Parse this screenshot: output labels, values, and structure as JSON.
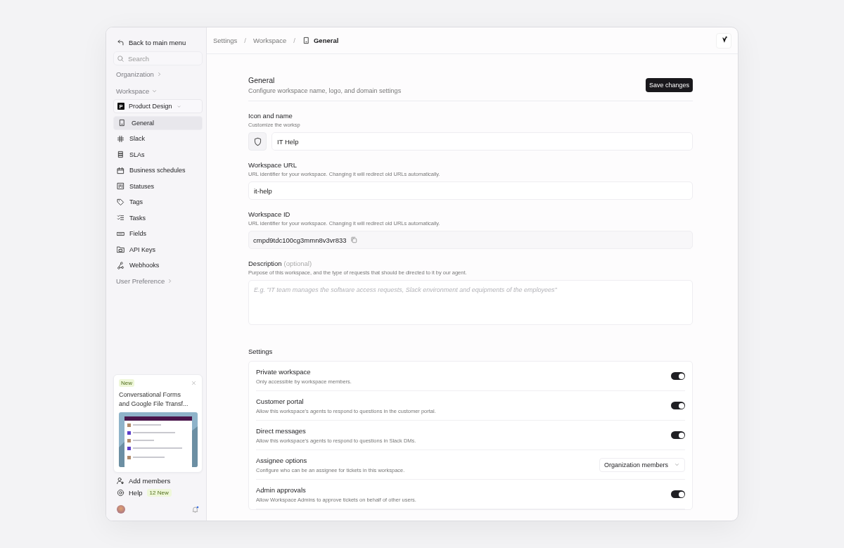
{
  "sidebar": {
    "back_link": "Back to main menu",
    "search": {
      "placeholder": "Search"
    },
    "organization": {
      "label": "Organization",
      "expanded": false
    },
    "workspace": {
      "label": "Workspace",
      "expanded": true,
      "selector": {
        "logo_letter": "P",
        "name": "Product Design"
      },
      "items": [
        {
          "label": "General",
          "selected": true
        },
        {
          "label": "Slack",
          "selected": false
        },
        {
          "label": "SLAs",
          "selected": false
        },
        {
          "label": "Business schedules",
          "selected": false
        },
        {
          "label": "Statuses",
          "selected": false
        },
        {
          "label": "Tags",
          "selected": false
        },
        {
          "label": "Tasks",
          "selected": false
        },
        {
          "label": "Fields",
          "selected": false
        },
        {
          "label": "API Keys",
          "selected": false
        },
        {
          "label": "Webhooks",
          "selected": false
        }
      ]
    },
    "user_preference": {
      "label": "User Preference",
      "expanded": false
    },
    "news_card": {
      "badge": "New",
      "title": "Conversational Forms and Google File Transf..."
    },
    "add_members": "Add members",
    "help": {
      "label": "Help",
      "badge": "12 New"
    },
    "notifications": {
      "unread": true
    }
  },
  "breadcrumb_separator": "/",
  "breadcrumbs": [
    {
      "label": "Settings",
      "current": false
    },
    {
      "label": "Workspace",
      "current": false
    },
    {
      "label": "General",
      "current": true
    }
  ],
  "header": {
    "title": "General",
    "subtitle": "Configure workspace name, logo, and domain settings",
    "save_button": "Save changes"
  },
  "fields": [
    {
      "kind": "icon_name",
      "label": "Icon and name",
      "hint": "Customize the worksp",
      "value": "IT Help"
    },
    {
      "kind": "text",
      "label": "Workspace URL",
      "hint": "URL identifier for your workspace. Changing it will redirect old URLs automatically.",
      "value": "it-help"
    },
    {
      "kind": "readonly",
      "label": "Workspace ID",
      "hint": "URL identifier for your workspace. Changing it will redirect old URLs automatically.",
      "value": "cmpd9tdc100cg3mmn8v3vr833"
    },
    {
      "kind": "textarea",
      "label": "Description",
      "optional": "(optional)",
      "hint": "Purpose of this workspace, and the type of requests that should be directed to it by our agent.",
      "placeholder": "E.g. \"IT team manages the software access requests, Slack environment and equipments of the employees\""
    }
  ],
  "settings": {
    "title": "Settings",
    "rows": [
      {
        "kind": "toggle",
        "label": "Private workspace",
        "description": "Only accessible by workspace members.",
        "on": true
      },
      {
        "kind": "toggle",
        "label": "Customer portal",
        "description": "Allow this workspace's agents to respond to questions in the customer portal.",
        "on": true
      },
      {
        "kind": "toggle",
        "label": "Direct messages",
        "description": "Allow this workspace's agents to respond to questions in Slack DMs.",
        "on": true
      },
      {
        "kind": "select",
        "label": "Assignee options",
        "description": "Configure who can be an assignee for tickets in this workspace.",
        "value": "Organization members"
      },
      {
        "kind": "toggle",
        "label": "Admin approvals",
        "description": "Allow Workspace Admins to approve tickets on behalf of other users.",
        "on": true
      }
    ]
  }
}
